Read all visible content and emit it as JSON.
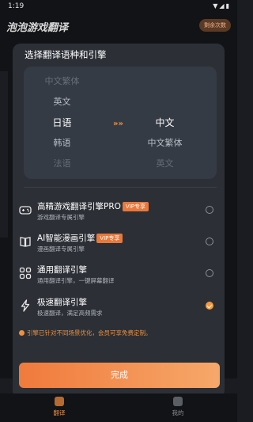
{
  "status_bar": {
    "time": "1:19"
  },
  "app": {
    "title": "泡泡游戏翻译",
    "quota_button": "剩余次数"
  },
  "modal": {
    "title": "选择翻译语种和引擎",
    "source_languages": [
      "中文繁体",
      "英文",
      "日语",
      "韩语",
      "法语"
    ],
    "source_selected": "日语",
    "target_languages": [
      "中文",
      "中文繁体",
      "英文"
    ],
    "target_selected": "中文",
    "arrow_symbol": "»",
    "engines": [
      {
        "name": "高精游戏翻译引擎PRO",
        "badge": "VIP专享",
        "desc": "游戏翻译专属引擎",
        "icon": "gamepad-icon",
        "checked": false
      },
      {
        "name": "AI智能漫画引擎",
        "badge": "VIP专享",
        "desc": "漫画翻译专属引擎",
        "icon": "book-icon",
        "checked": false
      },
      {
        "name": "通用翻译引擎",
        "badge": "",
        "desc": "通用翻译引擎，一键屏幕翻译",
        "icon": "grid-icon",
        "checked": false
      },
      {
        "name": "极速翻译引擎",
        "badge": "",
        "desc": "极速翻译，满足高频需求",
        "icon": "lightning-icon",
        "checked": true
      }
    ],
    "notice": "引擎已针对不同场景优化，会员可享免费定制。",
    "done_button": "完成"
  },
  "bottom_nav": {
    "items": [
      {
        "label": "翻译",
        "active": true
      },
      {
        "label": "我的",
        "active": false
      }
    ]
  },
  "colors": {
    "accent": "#f0903c",
    "modal_bg": "#2c3036",
    "picker_bg": "#353b44"
  }
}
